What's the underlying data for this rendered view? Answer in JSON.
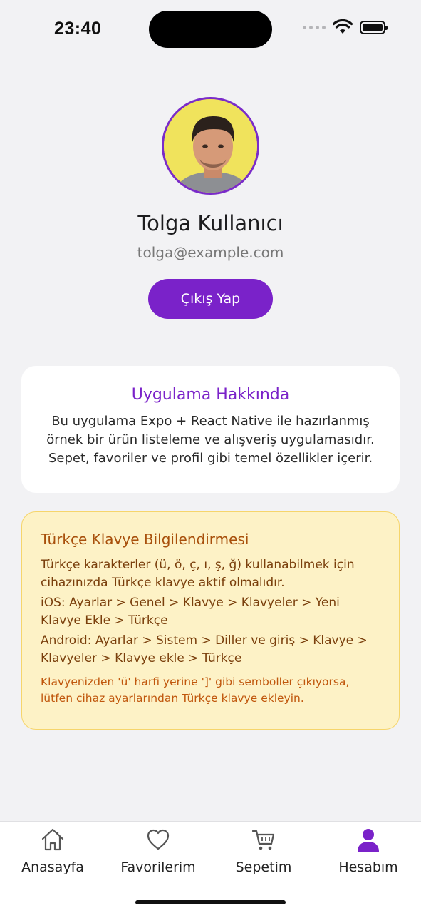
{
  "status_bar": {
    "time": "23:40"
  },
  "profile": {
    "name": "Tolga Kullanıcı",
    "email": "tolga@example.com",
    "logout_label": "Çıkış Yap"
  },
  "about": {
    "title": "Uygulama Hakkında",
    "text": "Bu uygulama Expo + React Native ile hazırlanmış örnek bir ürün listeleme ve alışveriş uygulamasıdır. Sepet, favoriler ve profil gibi temel özellikler içerir."
  },
  "keyboard_info": {
    "title": "Türkçe Klavye Bilgilendirmesi",
    "intro": "Türkçe karakterler (ü, ö, ç, ı, ş, ğ) kullanabilmek için cihazınızda Türkçe klavye aktif olmalıdır.",
    "ios": "iOS: Ayarlar > Genel > Klavye > Klavyeler > Yeni Klavye Ekle > Türkçe",
    "android": "Android: Ayarlar > Sistem > Diller ve giriş > Klavye > Klavyeler > Klavye ekle > Türkçe",
    "note": "Klavyenizden 'ü' harfi yerine ']' gibi semboller çıkıyorsa, lütfen cihaz ayarlarından Türkçe klavye ekleyin."
  },
  "tabs": [
    {
      "label": "Anasayfa",
      "icon": "home-icon",
      "active": false
    },
    {
      "label": "Favorilerim",
      "icon": "heart-icon",
      "active": false
    },
    {
      "label": "Sepetim",
      "icon": "cart-icon",
      "active": false
    },
    {
      "label": "Hesabım",
      "icon": "person-icon",
      "active": true
    }
  ],
  "colors": {
    "accent": "#7a22c9",
    "info_bg": "#fdf2c6",
    "info_border": "#f6d56b",
    "info_title": "#a8500c"
  }
}
